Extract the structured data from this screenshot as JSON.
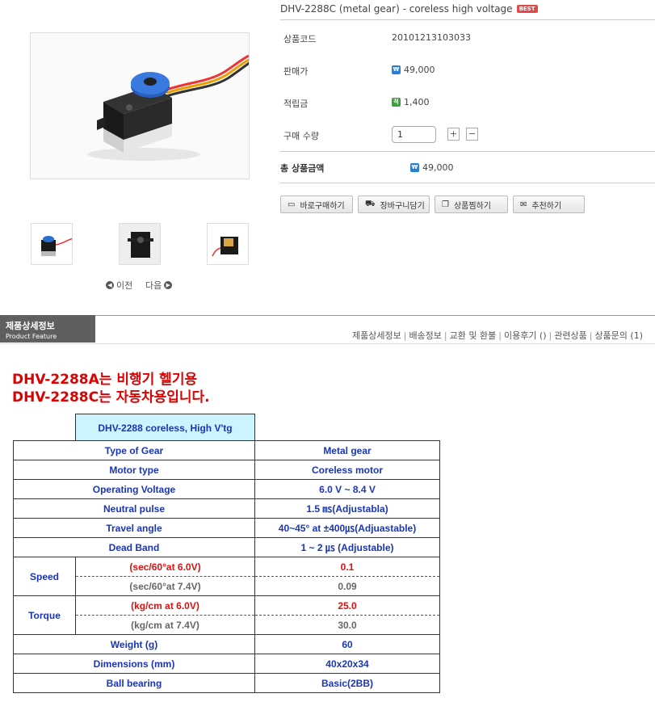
{
  "product": {
    "title": "DHV-2288C (metal gear) - coreless high voltage",
    "badge": "BEST",
    "rows": {
      "code_label": "상품코드",
      "code_value": "20101213103033",
      "price_label": "판매가",
      "price_value": "49,000",
      "points_label": "적립금",
      "points_value": "1,400",
      "qty_label": "구매 수량",
      "qty_value": "1",
      "plus": "+",
      "minus": "−",
      "total_label": "총 상품금액",
      "total_value": "49,000"
    },
    "buttons": {
      "buy_now": "바로구매하기",
      "add_cart": "장바구니담기",
      "wishlist": "상품찜하기",
      "recommend": "추천하기"
    },
    "pager": {
      "prev": "이전",
      "next": "다음"
    }
  },
  "section": {
    "tab_ko": "제품상세정보",
    "tab_en": "Product Feature",
    "nav": [
      "제품상세정보",
      "배송정보",
      "교환 및 환불",
      "이용후기 ()",
      "관련상품",
      "상품문의 (1)"
    ]
  },
  "detail": {
    "line1": "DHV-2288A는 비행기 헬기용",
    "line2": "DHV-2288C는 자동차용입니다.",
    "table_header": "DHV-2288 coreless, High V'tg",
    "spec": {
      "gear_label": "Type of Gear",
      "gear_value": "Metal  gear",
      "motor_label": "Motor type",
      "motor_value": "Coreless motor",
      "voltage_label": "Operating Voltage",
      "voltage_value": "6.0 V ~ 8.4 V",
      "neutral_label": "Neutral pulse",
      "neutral_value": "1.5 ㎳(Adjustabla)",
      "travel_label": "Travel angle",
      "travel_value": "40~45° at ±400㎲(Adjuastable)",
      "dead_label": "Dead Band",
      "dead_value": "1 ~ 2 ㎲ (Adjustable)",
      "speed_label": "Speed",
      "speed_a_label": "(sec/60°at 6.0V)",
      "speed_a_value": "0.1",
      "speed_b_label": "(sec/60°at 7.4V)",
      "speed_b_value": "0.09",
      "torque_label": "Torque",
      "torque_a_label": "(kg/cm at 6.0V)",
      "torque_a_value": "25.0",
      "torque_b_label": "(kg/cm at 7.4V)",
      "torque_b_value": "30.0",
      "weight_label": "Weight (g)",
      "weight_value": "60",
      "dim_label": "Dimensions (mm)",
      "dim_value": "40x20x34",
      "bearing_label": "Ball bearing",
      "bearing_value": "Basic(2BB)"
    }
  }
}
